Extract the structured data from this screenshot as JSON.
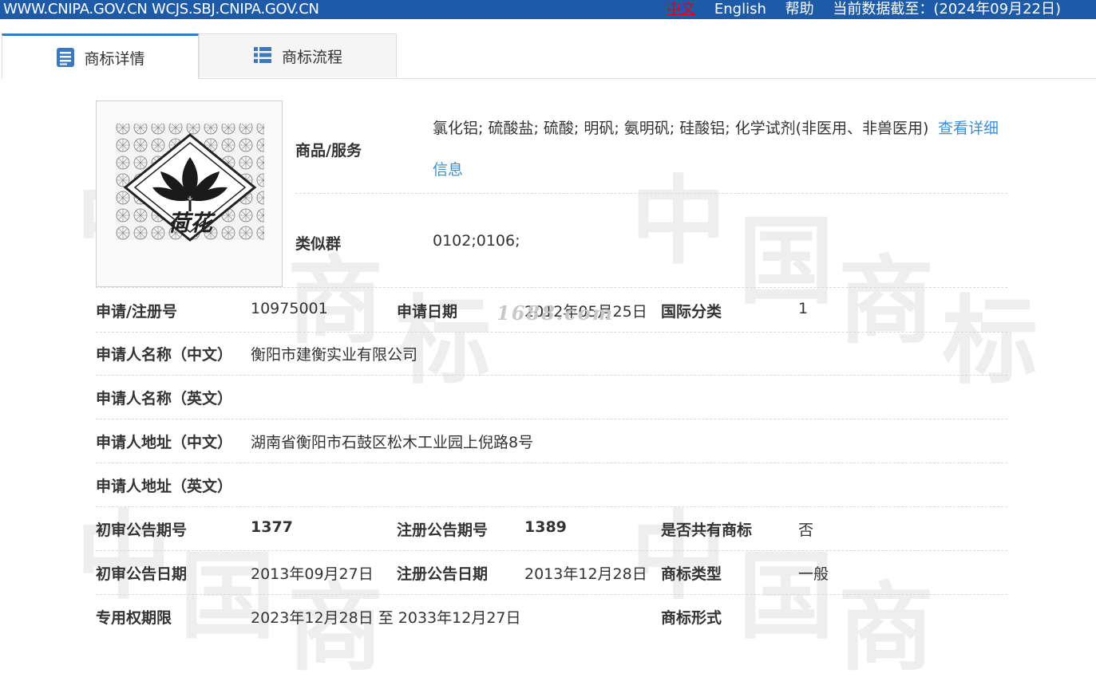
{
  "topbar": {
    "domains": "WWW.CNIPA.GOV.CN WCJS.SBJ.CNIPA.GOV.CN",
    "lang_cn": "中文",
    "lang_en": "English",
    "help": "帮助",
    "data_as_of": "当前数据截至：(2024年09月22日)"
  },
  "tabs": {
    "detail": "商标详情",
    "flow": "商标流程"
  },
  "watermark": {
    "glyphs": [
      "中",
      "国",
      "商",
      "标"
    ],
    "site": "1688.com"
  },
  "trademark_image": {
    "text": "荷花",
    "icon": "lotus-icon"
  },
  "goods": {
    "label": "商品/服务",
    "value": "氯化铝; 硫酸盐; 硫酸; 明矾; 氨明矾; 硅酸铝; 化学试剂(非医用、非兽医用)",
    "link_part1": "查看详细",
    "link_part2": "信息"
  },
  "similar_group": {
    "label": "类似群",
    "value": "0102;0106;"
  },
  "rows": {
    "reg_no_label": "申请/注册号",
    "reg_no": "10975001",
    "app_date_label": "申请日期",
    "app_date": "2012年05月25日",
    "intl_class_label": "国际分类",
    "intl_class": "1",
    "applicant_cn_label": "申请人名称（中文）",
    "applicant_cn": "衡阳市建衡实业有限公司",
    "applicant_en_label": "申请人名称（英文）",
    "applicant_en": "",
    "address_cn_label": "申请人地址（中文）",
    "address_cn": "湖南省衡阳市石鼓区松木工业园上倪路8号",
    "address_en_label": "申请人地址（英文）",
    "address_en": "",
    "prelim_no_label": "初审公告期号",
    "prelim_no": "1377",
    "reg_ann_no_label": "注册公告期号",
    "reg_ann_no": "1389",
    "shared_label": "是否共有商标",
    "shared": "否",
    "prelim_date_label": "初审公告日期",
    "prelim_date": "2013年09月27日",
    "reg_ann_date_label": "注册公告日期",
    "reg_ann_date": "2013年12月28日",
    "tm_type_label": "商标类型",
    "tm_type": "一般",
    "term_label": "专用权期限",
    "term": "2023年12月28日 至 2033年12月27日",
    "tm_form_label": "商标形式",
    "tm_form": ""
  }
}
